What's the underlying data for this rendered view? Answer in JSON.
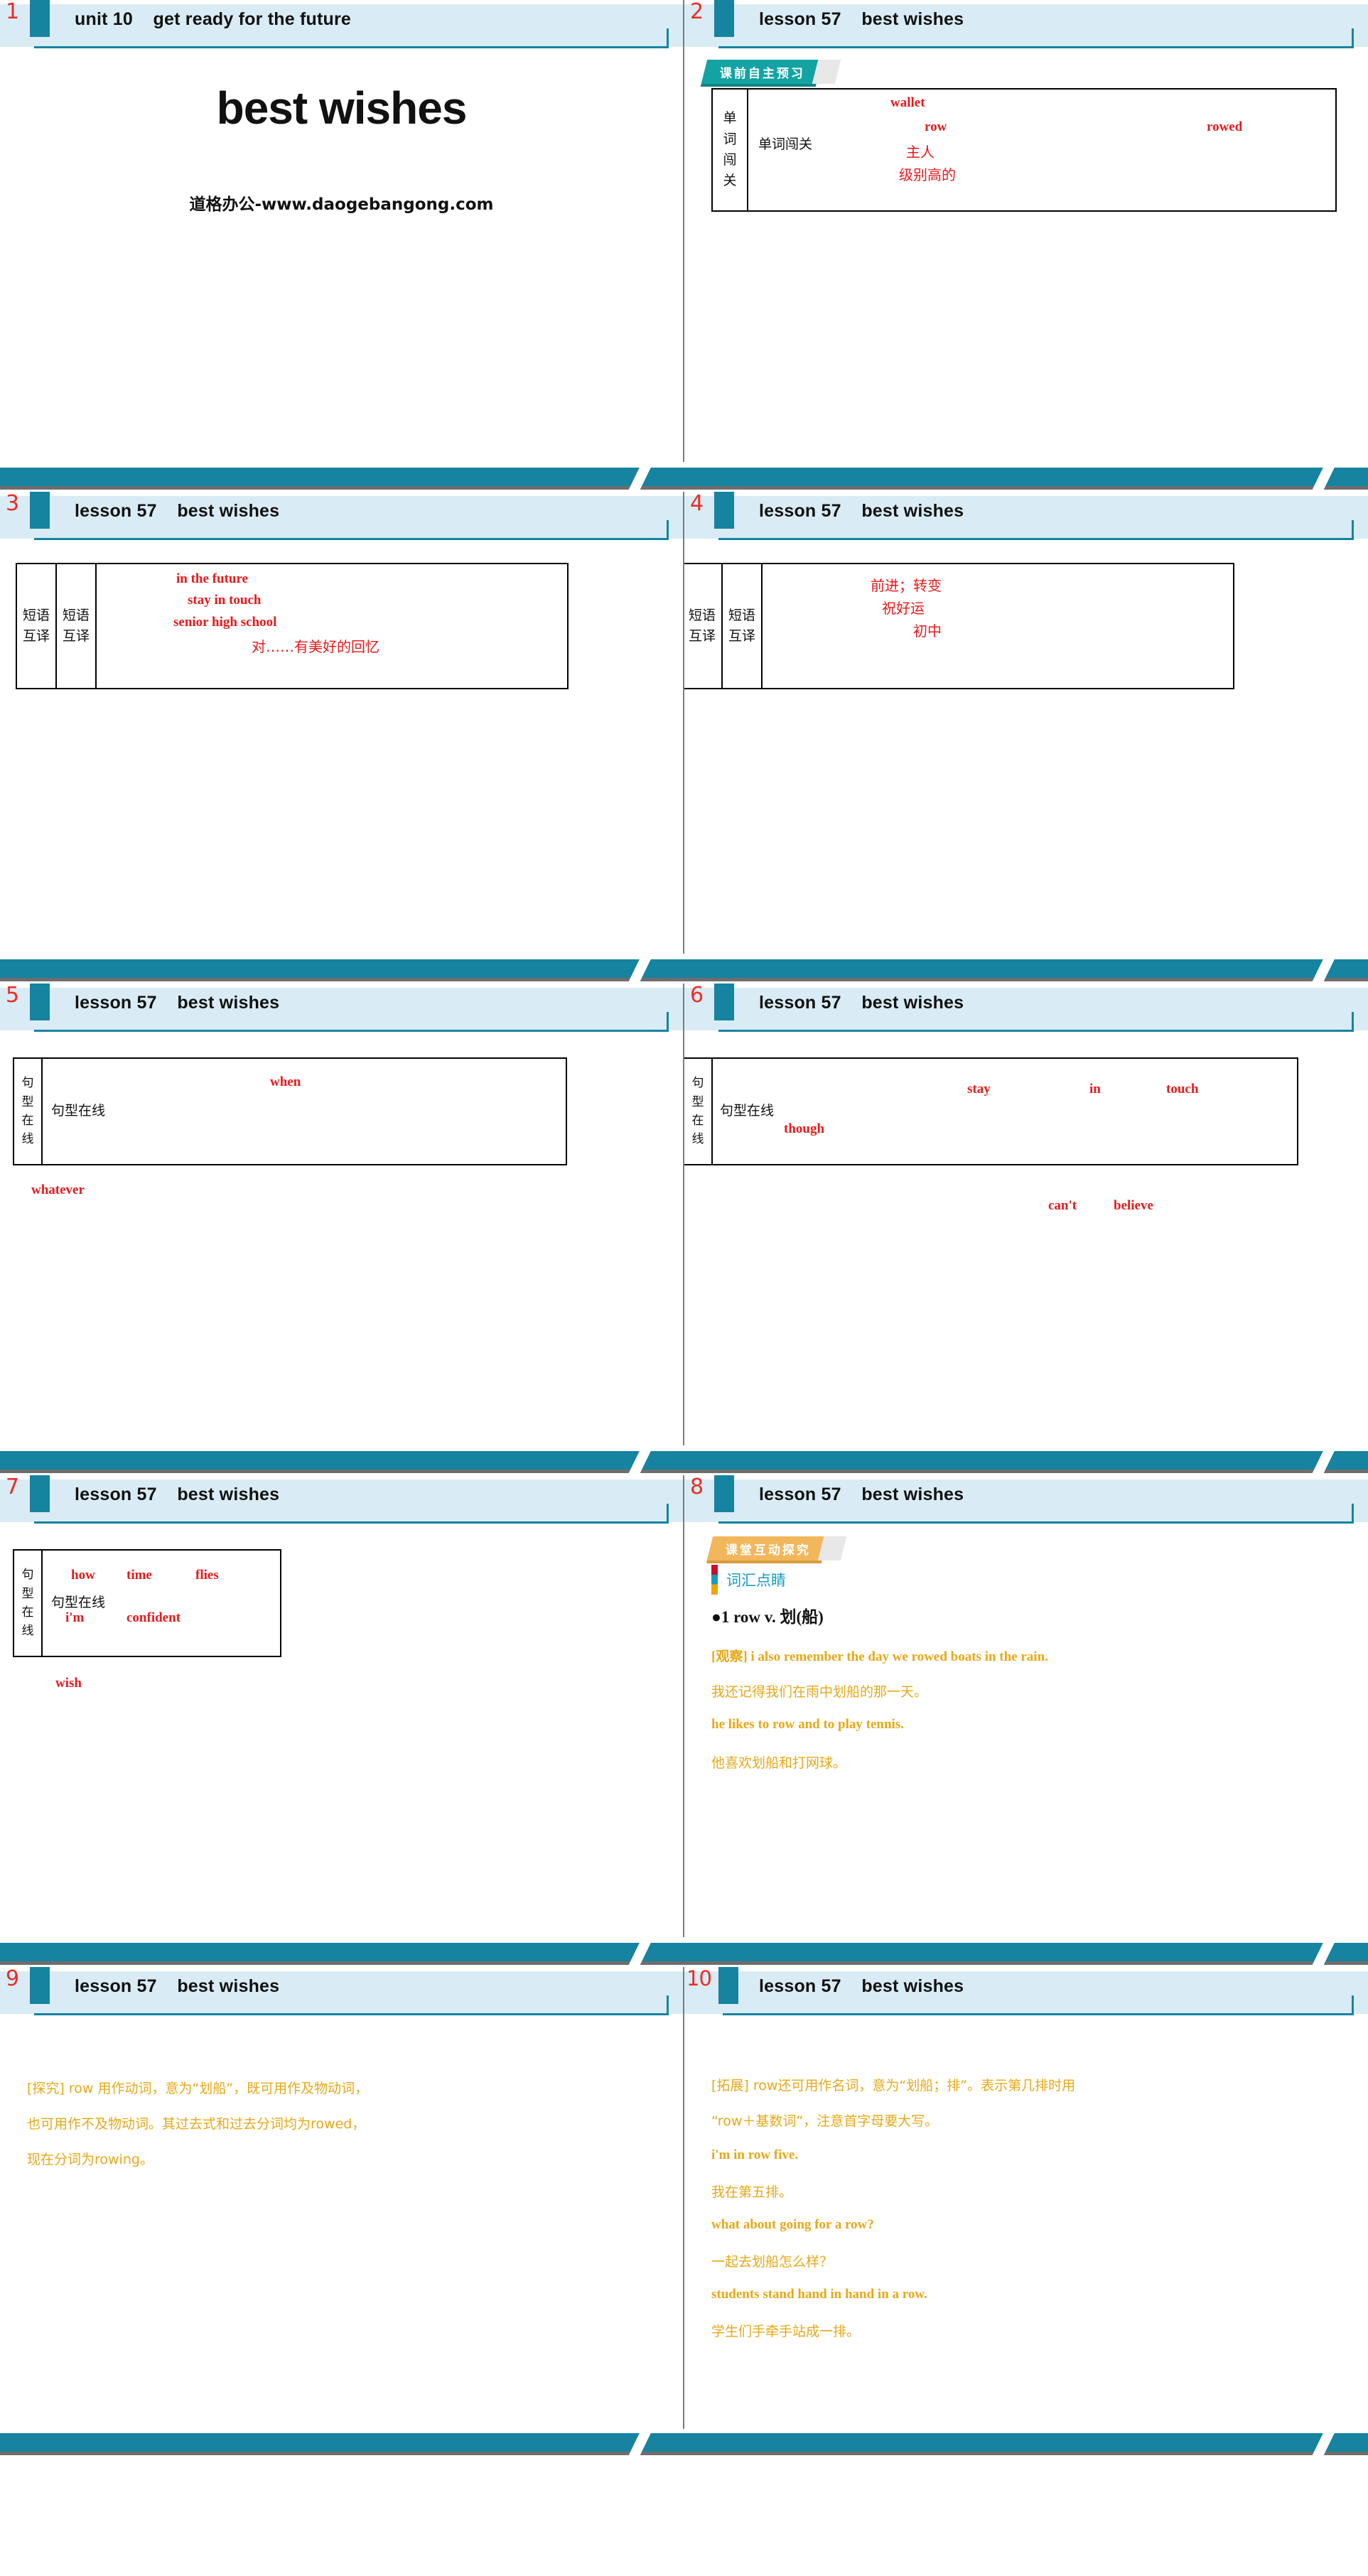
{
  "colors": {
    "teal": "#1683a0",
    "header_bg": "#d9ecf5",
    "answer_red": "#e8191b",
    "gold": "#e6a817",
    "badge_teal": "#14a3a3",
    "badge_orange": "#f2b75c",
    "number_red": "#ef2b24"
  },
  "slides": [
    {
      "number": "1",
      "header_title": "unit 10    get ready for the future",
      "cover_title": "best wishes",
      "cover_subtitle": "道格办公-www.daogebangong.com"
    },
    {
      "number": "2",
      "header_title": "lesson 57    best wishes",
      "badge": "课前自主预习",
      "table": {
        "side_label": "单词闯关",
        "inline_label": "单词闯关",
        "answers": [
          "wallet",
          "row",
          "rowed",
          "主人",
          "级别高的"
        ]
      }
    },
    {
      "number": "3",
      "header_title": "lesson 57    best wishes",
      "table": {
        "side_label_a": "短语互译",
        "side_label_b": "短语互译",
        "answers": [
          "in the future",
          "stay in touch",
          "senior high school",
          "对……有美好的回忆"
        ]
      }
    },
    {
      "number": "4",
      "header_title": "lesson 57    best wishes",
      "table": {
        "side_label_a": "短语互译",
        "side_label_b": "短语互译",
        "answers": [
          "前进；转变",
          "祝好运",
          "初中"
        ]
      }
    },
    {
      "number": "5",
      "header_title": "lesson 57    best wishes",
      "table": {
        "side_label": "句型在线",
        "inline_label": "句型在线",
        "answers": [
          "when"
        ]
      },
      "outside_answers": [
        "whatever"
      ]
    },
    {
      "number": "6",
      "header_title": "lesson 57    best wishes",
      "table": {
        "side_label": "句型在线",
        "inline_label": "句型在线",
        "answers": [
          "stay",
          "in",
          "touch",
          "though"
        ]
      },
      "outside_answers": [
        "can't",
        "believe"
      ]
    },
    {
      "number": "7",
      "header_title": "lesson 57    best wishes",
      "table": {
        "side_label": "句型在线",
        "inline_label": "句型在线",
        "answers": [
          "how",
          "time",
          "flies",
          "i'm",
          "confident"
        ]
      },
      "outside_answers": [
        "wish"
      ]
    },
    {
      "number": "8",
      "header_title": "lesson 57    best wishes",
      "badge": "课堂互动探究",
      "section_title": "词汇点睛",
      "entry": "●1   row v. 划(船)",
      "lines": [
        "[观察] i also remember the day we rowed boats in the rain.",
        "我还记得我们在雨中划船的那一天。",
        "he likes to row and to play tennis.",
        "他喜欢划船和打网球。"
      ]
    },
    {
      "number": "9",
      "header_title": "lesson 57    best wishes",
      "lines": [
        "[探究] row 用作动词，意为“划船”，既可用作及物动词，",
        "也可用作不及物动词。其过去式和过去分词均为rowed，",
        "现在分词为rowing。"
      ]
    },
    {
      "number": "10",
      "header_title": "lesson 57    best wishes",
      "lines": [
        "[拓展] row还可用作名词，意为“划船；排”。表示第几排时用",
        "“row＋基数词”，注意首字母要大写。",
        "i'm in row five.",
        "我在第五排。",
        "what about going for a row?",
        "一起去划船怎么样？",
        "students stand hand in hand in a row.",
        "学生们手牵手站成一排。"
      ]
    }
  ]
}
